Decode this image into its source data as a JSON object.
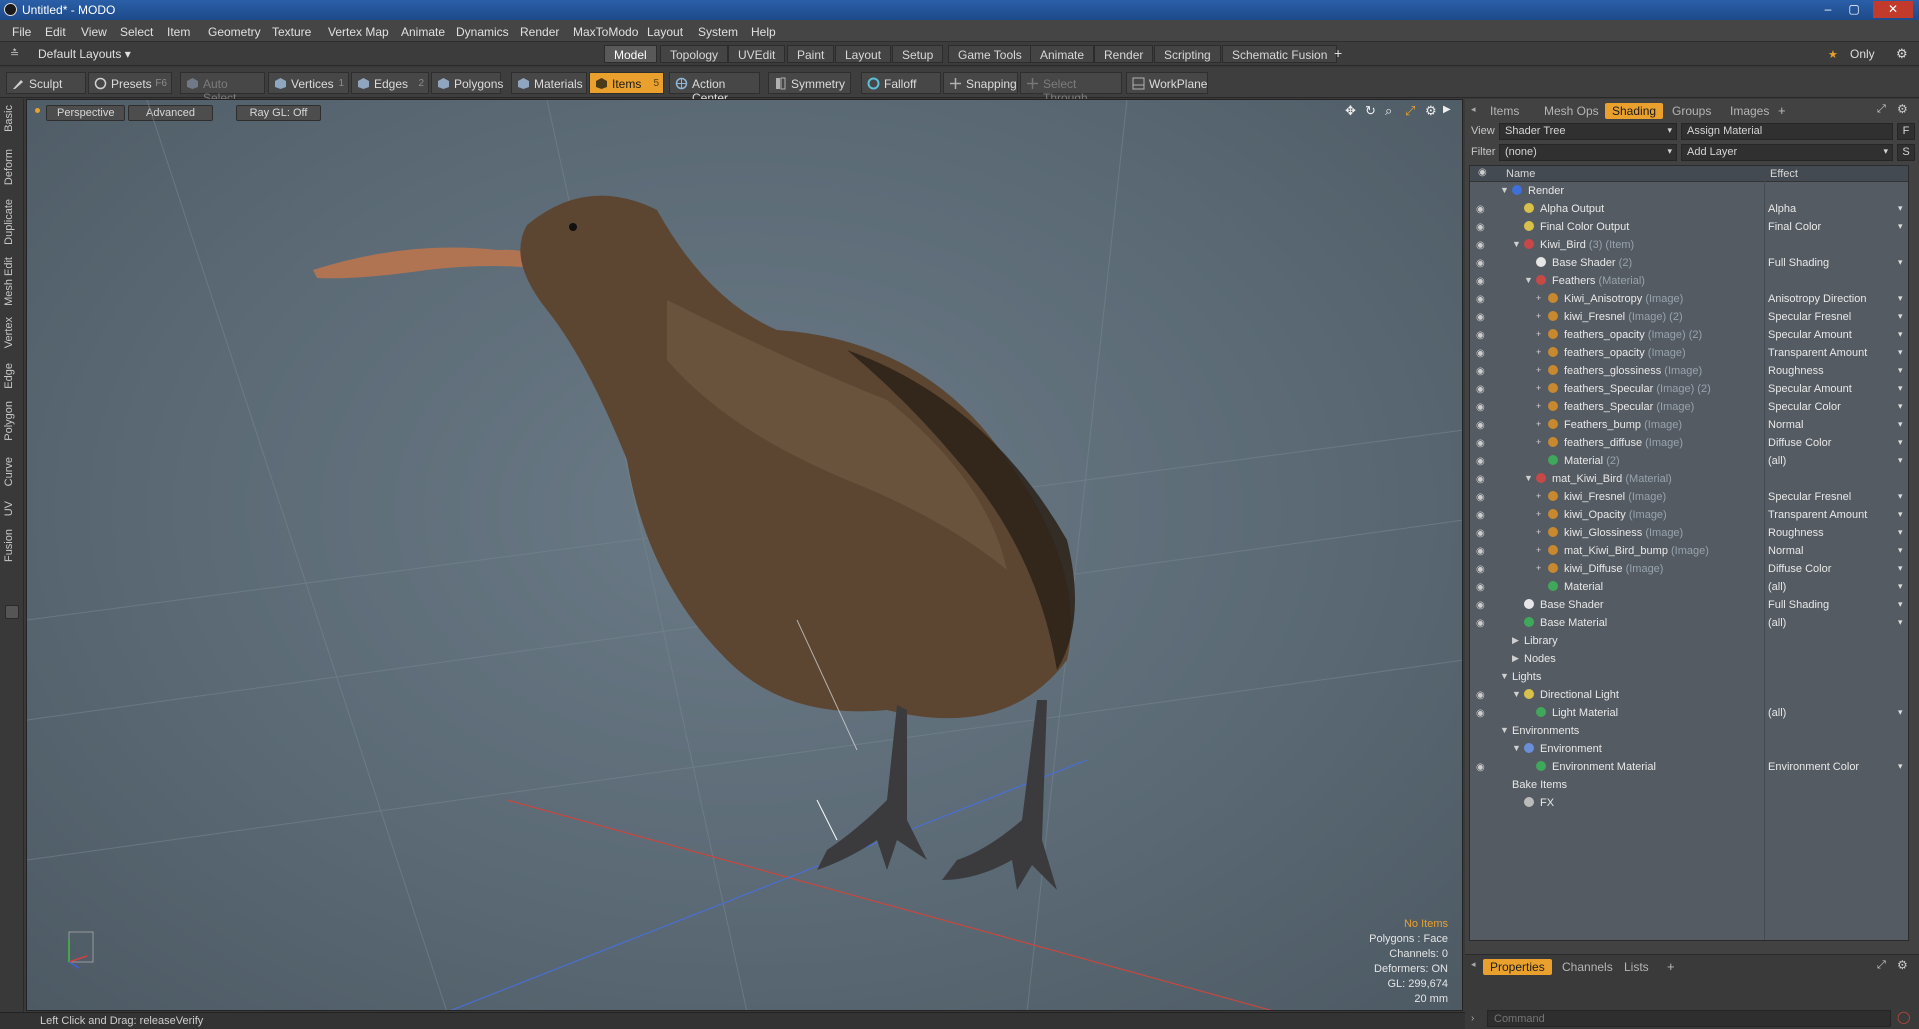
{
  "window": {
    "title": "Untitled* - MODO",
    "min": "–",
    "max": "▢",
    "close": "✕"
  },
  "menu": [
    "File",
    "Edit",
    "View",
    "Select",
    "Item",
    "Geometry",
    "Texture",
    "Vertex Map",
    "Animate",
    "Dynamics",
    "Render",
    "MaxToModo",
    "Layout",
    "System",
    "Help"
  ],
  "layouts_label": "Default Layouts ▾",
  "workspace_tabs": [
    "Model",
    "Topology",
    "UVEdit",
    "Paint",
    "Layout",
    "Setup",
    "Game Tools",
    "Animate",
    "Render",
    "Scripting",
    "Schematic Fusion"
  ],
  "add_tab": "+",
  "only_label": "Only",
  "toolbar": {
    "sculpt": "Sculpt",
    "presets": "Presets",
    "presets_key": "F6",
    "auto_select": "Auto Select",
    "vertices": "Vertices",
    "vertices_key": "1",
    "edges": "Edges",
    "edges_key": "2",
    "polygons": "Polygons",
    "materials": "Materials",
    "items": "Items",
    "items_key": "5",
    "action_center": "Action Center",
    "symmetry": "Symmetry",
    "falloff": "Falloff",
    "snapping": "Snapping",
    "select_through": "Select Through",
    "workplane": "WorkPlane"
  },
  "left_tabs": [
    "Basic",
    "Deform",
    "Duplicate",
    "Mesh Edit",
    "Vertex",
    "Edge",
    "Polygon",
    "Curve",
    "UV",
    "Fusion"
  ],
  "viewport": {
    "view_mode": "Perspective",
    "shading": "Advanced",
    "raygl": "Ray GL: Off",
    "info": {
      "items": "No Items",
      "polygons": "Polygons : Face",
      "channels": "Channels: 0",
      "deformers": "Deformers: ON",
      "gl": "GL: 299,674",
      "scale": "20 mm"
    },
    "accent": "#e9a02d"
  },
  "status": "Left Click and Drag:   releaseVerify",
  "right_panel": {
    "tabs": [
      "Items",
      "Mesh Ops",
      "Shading",
      "Groups",
      "Images"
    ],
    "add_tab": "+",
    "view_label": "View",
    "view_value": "Shader Tree",
    "assign_material": "Assign Material",
    "f_button": "F",
    "filter_label": "Filter",
    "filter_value": "(none)",
    "add_layer": "Add Layer",
    "s_button": "S",
    "columns": {
      "name": "Name",
      "effect": "Effect"
    }
  },
  "tree": [
    {
      "name": "Render",
      "sub": "",
      "effect": "",
      "indent": 0,
      "eye": false,
      "twist": "▼",
      "icon": "#3f6fd8",
      "dd": false
    },
    {
      "name": "Alpha Output",
      "sub": "",
      "effect": "Alpha",
      "indent": 1,
      "eye": true,
      "twist": "",
      "icon": "#d8c04a",
      "dd": true
    },
    {
      "name": "Final Color Output",
      "sub": "",
      "effect": "Final Color",
      "indent": 1,
      "eye": true,
      "twist": "",
      "icon": "#d8c04a",
      "dd": true
    },
    {
      "name": "Kiwi_Bird",
      "sub": "(3) (Item)",
      "effect": "",
      "indent": 1,
      "eye": true,
      "twist": "▼",
      "icon": "#c84848",
      "dd": false
    },
    {
      "name": "Base Shader",
      "sub": "(2)",
      "effect": "Full Shading",
      "indent": 2,
      "eye": true,
      "twist": "",
      "icon": "#e6e6e6",
      "dd": true
    },
    {
      "name": "Feathers",
      "sub": "(Material)",
      "effect": "",
      "indent": 2,
      "eye": true,
      "twist": "▼",
      "icon": "#c84848",
      "dd": false
    },
    {
      "name": "Kiwi_Anisotropy",
      "sub": "(Image)",
      "effect": "Anisotropy Direction",
      "indent": 3,
      "eye": true,
      "twist": "+",
      "icon": "#c8882e",
      "dd": true
    },
    {
      "name": "kiwi_Fresnel",
      "sub": "(Image) (2)",
      "effect": "Specular Fresnel",
      "indent": 3,
      "eye": true,
      "twist": "+",
      "icon": "#c8882e",
      "dd": true
    },
    {
      "name": "feathers_opacity",
      "sub": "(Image) (2)",
      "effect": "Specular Amount",
      "indent": 3,
      "eye": true,
      "twist": "+",
      "icon": "#c8882e",
      "dd": true
    },
    {
      "name": "feathers_opacity",
      "sub": "(Image)",
      "effect": "Transparent Amount",
      "indent": 3,
      "eye": true,
      "twist": "+",
      "icon": "#c8882e",
      "dd": true
    },
    {
      "name": "feathers_glossiness",
      "sub": "(Image)",
      "effect": "Roughness",
      "indent": 3,
      "eye": true,
      "twist": "+",
      "icon": "#c8882e",
      "dd": true
    },
    {
      "name": "feathers_Specular",
      "sub": "(Image) (2)",
      "effect": "Specular Amount",
      "indent": 3,
      "eye": true,
      "twist": "+",
      "icon": "#c8882e",
      "dd": true
    },
    {
      "name": "feathers_Specular",
      "sub": "(Image)",
      "effect": "Specular Color",
      "indent": 3,
      "eye": true,
      "twist": "+",
      "icon": "#c8882e",
      "dd": true
    },
    {
      "name": "Feathers_bump",
      "sub": "(Image)",
      "effect": "Normal",
      "indent": 3,
      "eye": true,
      "twist": "+",
      "icon": "#c8882e",
      "dd": true
    },
    {
      "name": "feathers_diffuse",
      "sub": "(Image)",
      "effect": "Diffuse Color",
      "indent": 3,
      "eye": true,
      "twist": "+",
      "icon": "#c8882e",
      "dd": true
    },
    {
      "name": "Material",
      "sub": "(2)",
      "effect": "(all)",
      "indent": 3,
      "eye": true,
      "twist": "",
      "icon": "#3fa85a",
      "dd": true
    },
    {
      "name": "mat_Kiwi_Bird",
      "sub": "(Material)",
      "effect": "",
      "indent": 2,
      "eye": true,
      "twist": "▼",
      "icon": "#c84848",
      "dd": false
    },
    {
      "name": "kiwi_Fresnel",
      "sub": "(Image)",
      "effect": "Specular Fresnel",
      "indent": 3,
      "eye": true,
      "twist": "+",
      "icon": "#c8882e",
      "dd": true
    },
    {
      "name": "kiwi_Opacity",
      "sub": "(Image)",
      "effect": "Transparent Amount",
      "indent": 3,
      "eye": true,
      "twist": "+",
      "icon": "#c8882e",
      "dd": true
    },
    {
      "name": "kiwi_Glossiness",
      "sub": "(Image)",
      "effect": "Roughness",
      "indent": 3,
      "eye": true,
      "twist": "+",
      "icon": "#c8882e",
      "dd": true
    },
    {
      "name": "mat_Kiwi_Bird_bump",
      "sub": "(Image)",
      "effect": "Normal",
      "indent": 3,
      "eye": true,
      "twist": "+",
      "icon": "#c8882e",
      "dd": true
    },
    {
      "name": "kiwi_Diffuse",
      "sub": "(Image)",
      "effect": "Diffuse Color",
      "indent": 3,
      "eye": true,
      "twist": "+",
      "icon": "#c8882e",
      "dd": true
    },
    {
      "name": "Material",
      "sub": "",
      "effect": "(all)",
      "indent": 3,
      "eye": true,
      "twist": "",
      "icon": "#3fa85a",
      "dd": true
    },
    {
      "name": "Base Shader",
      "sub": "",
      "effect": "Full Shading",
      "indent": 1,
      "eye": true,
      "twist": "",
      "icon": "#e6e6e6",
      "dd": true
    },
    {
      "name": "Base Material",
      "sub": "",
      "effect": "(all)",
      "indent": 1,
      "eye": true,
      "twist": "",
      "icon": "#3fa85a",
      "dd": true
    },
    {
      "name": "Library",
      "sub": "",
      "effect": "",
      "indent": 1,
      "eye": false,
      "twist": "▶",
      "icon": "",
      "dd": false
    },
    {
      "name": "Nodes",
      "sub": "",
      "effect": "",
      "indent": 1,
      "eye": false,
      "twist": "▶",
      "icon": "",
      "dd": false
    },
    {
      "name": "Lights",
      "sub": "",
      "effect": "",
      "indent": 0,
      "eye": false,
      "twist": "▼",
      "icon": "",
      "dd": false
    },
    {
      "name": "Directional Light",
      "sub": "",
      "effect": "",
      "indent": 1,
      "eye": true,
      "twist": "▼",
      "icon": "#d8c04a",
      "dd": false
    },
    {
      "name": "Light Material",
      "sub": "",
      "effect": "(all)",
      "indent": 2,
      "eye": true,
      "twist": "",
      "icon": "#3fa85a",
      "dd": true
    },
    {
      "name": "Environments",
      "sub": "",
      "effect": "",
      "indent": 0,
      "eye": false,
      "twist": "▼",
      "icon": "",
      "dd": false
    },
    {
      "name": "Environment",
      "sub": "",
      "effect": "",
      "indent": 1,
      "eye": false,
      "twist": "▼",
      "icon": "#6a8fd8",
      "dd": false
    },
    {
      "name": "Environment Material",
      "sub": "",
      "effect": "Environment Color",
      "indent": 2,
      "eye": true,
      "twist": "",
      "icon": "#3fa85a",
      "dd": true
    },
    {
      "name": "Bake Items",
      "sub": "",
      "effect": "",
      "indent": 0,
      "eye": false,
      "twist": "",
      "icon": "",
      "dd": false
    },
    {
      "name": "FX",
      "sub": "",
      "effect": "",
      "indent": 1,
      "eye": false,
      "twist": "",
      "icon": "#bbbbbb",
      "dd": false
    }
  ],
  "bottom_panel": {
    "tabs": [
      "Properties",
      "Channels",
      "Lists"
    ],
    "add_tab": "+",
    "command_placeholder": "Command"
  }
}
